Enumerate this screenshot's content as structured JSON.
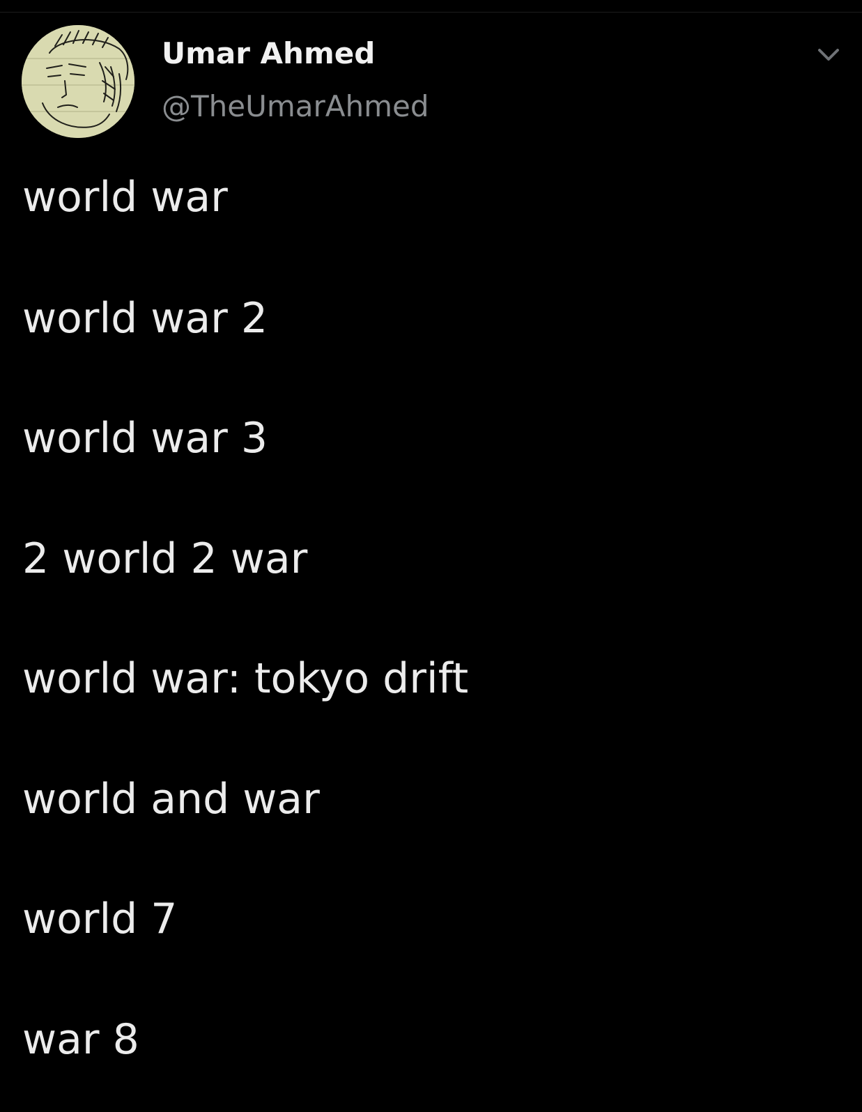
{
  "tweet": {
    "author": {
      "name": "Umar Ahmed",
      "handle": "@TheUmarAhmed"
    },
    "menu_icon": "chevron-down-icon",
    "avatar_icon": "hand-drawn-face-avatar",
    "lines": [
      "world war",
      "world war 2",
      "world war 3",
      "2 world 2 war",
      "world war: tokyo drift",
      "world and war",
      "world 7",
      "war 8"
    ]
  },
  "colors": {
    "background": "#000000",
    "text": "#ececec",
    "handle": "#8a8d90",
    "avatar_bg": "#d9dab0"
  }
}
